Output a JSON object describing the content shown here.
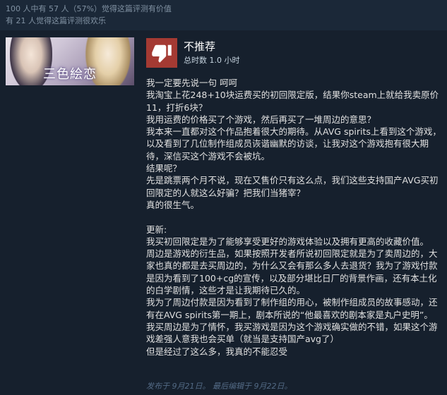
{
  "helpful": {
    "line1": "100 人中有 57 人（57%）觉得这篇评测有价值",
    "line2": "有 21 人觉得这篇评测很欢乐"
  },
  "game": {
    "banner_title": "三色絵恋",
    "icon": "game-banner-art"
  },
  "review": {
    "verdict": "不推荐",
    "verdict_icon": "thumbs-down-icon",
    "verdict_color": "#a43a33",
    "hours": "总时数 1.0 小时",
    "body": "我一定要先说一句 呵呵\n我淘宝上花248+10块运费买的初回限定版，结果你steam上就给我卖原价11，打折6块？\n我用运费的价格买了个游戏，然后再买了一堆周边的意思？\n我本来一直都对这个作品抱着很大的期待。从AVG spirits上看到这个游戏，以及看到了几位制作组成员诙谐幽默的访谈，让我对这个游戏抱有很大期待，深信买这个游戏不会被坑。\n结果呢？\n先是跳票两个月不说，现在又售价只有这么点，我们这些支持国产AVG买初回限定的人就这么好骗？把我们当猪宰？\n真的很生气。\n\n更新:\n我买初回限定是为了能够享受更好的游戏体验以及拥有更高的收藏价值。\n周边是游戏的衍生品，如果按照开发者所说初回限定就是为了卖周边的，大家也真的都是去买周边的，为什么又会有那么多人去退货？我为了游戏付款是因为看到了100+cg的宣传，以及部分堪比日厂的背景作画，还有本土化的白学剧情，这些才是让我期待已久的。\n我为了周边付款是因为看到了制作组的用心，被制作组成员的故事感动，还有在AVG spirits第一期上，剧本所说的“他最喜欢的剧本家是丸户史明”。\n我买周边是为了情怀，我买游戏是因为这个游戏确实做的不错，如果这个游戏差强人意我也会买单（就当是支持国产avg了）\n但是经过了这么多，我真的不能忍受",
    "posted": "发布于 9月21日。 最后编辑于 9月22日。"
  },
  "colors": {
    "page_bg": "#1b2838",
    "panel_bg": "#16202d"
  }
}
